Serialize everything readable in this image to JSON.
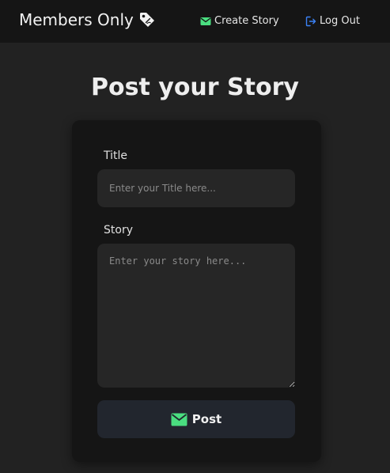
{
  "navbar": {
    "brand": "Members Only",
    "brand_icon": "tag-icon",
    "links": [
      {
        "label": "Create Story",
        "icon": "envelope-icon",
        "icon_color": "#4ade80"
      },
      {
        "label": "Log Out",
        "icon": "logout-icon",
        "icon_color": "#3b82f6"
      }
    ]
  },
  "main": {
    "title": "Post your Story",
    "form": {
      "title_label": "Title",
      "title_placeholder": "Enter your Title here...",
      "title_value": "",
      "story_label": "Story",
      "story_placeholder": "Enter your story here...",
      "story_value": "",
      "submit_label": "Post",
      "submit_icon": "envelope-icon",
      "submit_icon_color": "#4ade80"
    }
  },
  "colors": {
    "background": "#222222",
    "navbar": "#151515",
    "card": "#151515",
    "input": "#262626",
    "button": "#22262e"
  }
}
